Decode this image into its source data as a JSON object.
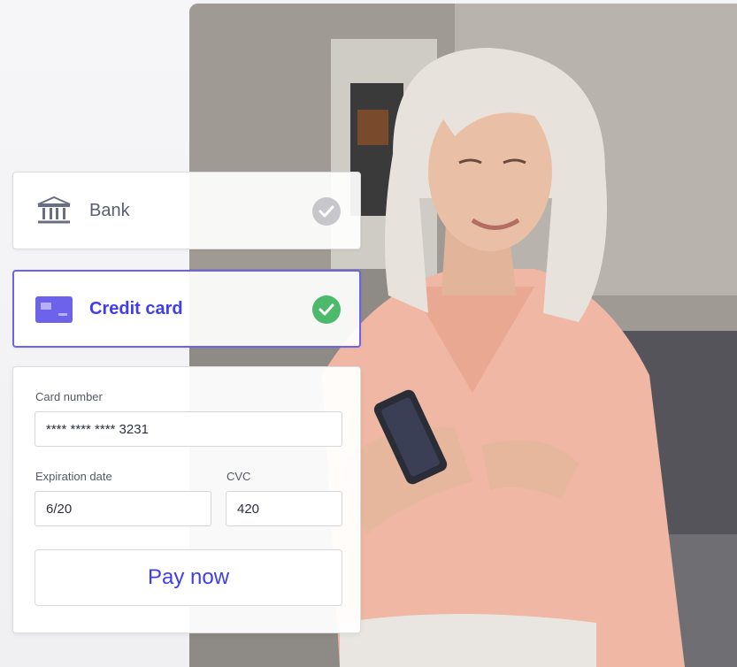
{
  "payment_options": {
    "bank": {
      "label": "Bank",
      "icon": "bank-icon",
      "status_icon": "check-circle-icon",
      "status_color": "#c7c7cb"
    },
    "credit_card": {
      "label": "Credit card",
      "icon": "credit-card-icon",
      "status_icon": "check-circle-icon",
      "status_color": "#4cba6a",
      "accent": "#3f3df0"
    }
  },
  "card_form": {
    "card_number_label": "Card number",
    "card_number_value": "**** **** **** 3231",
    "expiration_label": "Expiration date",
    "expiration_value": "6/20",
    "cvc_label": "CVC",
    "cvc_value": "420",
    "pay_button_label": "Pay now"
  },
  "colors": {
    "accent": "#3f3df0",
    "selected_border": "#6d62ea",
    "success": "#4cba6a"
  }
}
